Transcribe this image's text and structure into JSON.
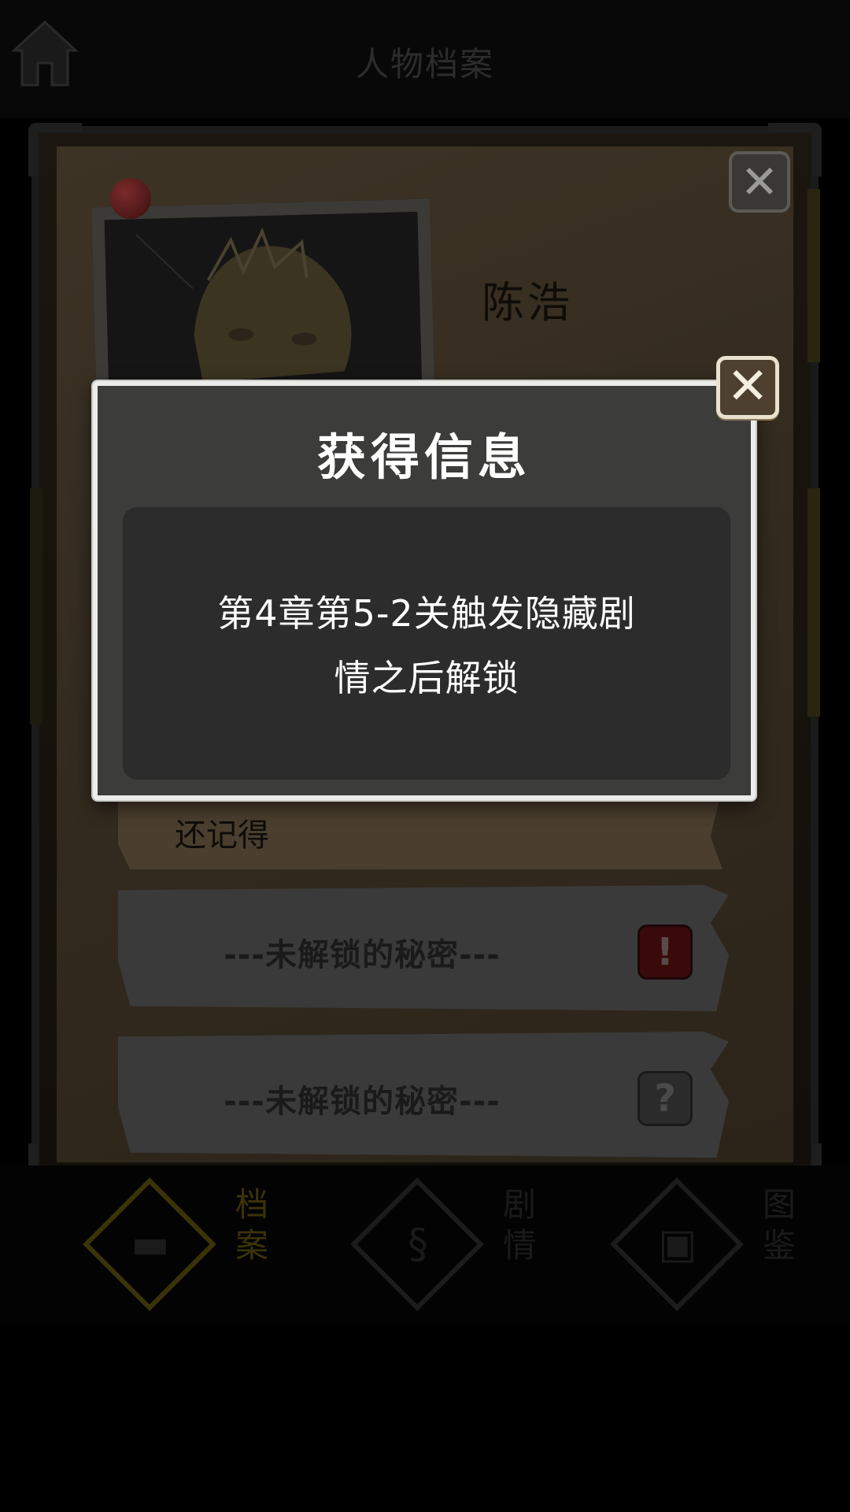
{
  "header": {
    "title": "人物档案"
  },
  "archive": {
    "character_name": "陈浩",
    "memory_snippet": "还记得",
    "secrets": [
      {
        "label": "---未解锁的秘密---",
        "badge": "!"
      },
      {
        "label": "---未解锁的秘密---",
        "badge": "?"
      }
    ],
    "close_glyph": "✕"
  },
  "bottom_nav": {
    "items": [
      {
        "label": "档案",
        "icon": "folder-icon",
        "active": true
      },
      {
        "label": "剧情",
        "icon": "scroll-icon",
        "active": false
      },
      {
        "label": "图鉴",
        "icon": "picture-icon",
        "active": false
      }
    ]
  },
  "dialog": {
    "title": "获得信息",
    "message_line1": "第4章第5-2关触发隐藏剧",
    "message_line2": "情之后解锁",
    "close_glyph": "✕"
  },
  "colors": {
    "dialog_bg": "#3c3c3a",
    "dialog_border": "#ececea",
    "overlay": "#000000",
    "active_nav": "#3b3308"
  }
}
